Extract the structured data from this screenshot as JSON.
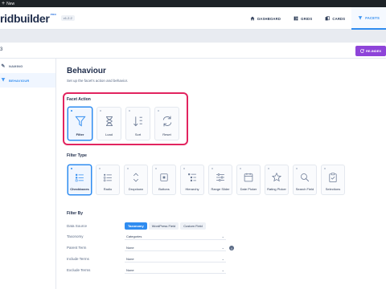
{
  "wpbar": {
    "plus": "+",
    "new_label": "New"
  },
  "header": {
    "logo_text": "ridbuilder",
    "pro_badge": "ᴘʀᴏ",
    "version": "v1.2.2",
    "nav": [
      {
        "label": "DASHBOARD",
        "icon": "home-icon"
      },
      {
        "label": "GRIDS",
        "icon": "grid-icon"
      },
      {
        "label": "CARDS",
        "icon": "cards-icon"
      },
      {
        "label": "FACETS",
        "icon": "filter-icon",
        "active": true
      }
    ]
  },
  "subheader": {
    "facet_id": "3",
    "reindex_label": "RE-INDEX"
  },
  "sidebar": {
    "items": [
      {
        "label": "NAMING",
        "icon": "pencil-icon"
      },
      {
        "label": "BEHAVIOUR",
        "icon": "filter-icon",
        "active": true
      }
    ]
  },
  "main": {
    "title": "Behaviour",
    "subtitle": "Set up the facet's action and behavior.",
    "facet_action": {
      "title": "Facet Action",
      "options": [
        {
          "label": "Filter",
          "icon": "funnel-icon",
          "selected": true
        },
        {
          "label": "Load",
          "icon": "hourglass-icon"
        },
        {
          "label": "Sort",
          "icon": "sort-icon"
        },
        {
          "label": "Reset",
          "icon": "refresh-icon"
        }
      ]
    },
    "filter_type": {
      "title": "Filter Type",
      "options": [
        {
          "label": "Checkboxes",
          "icon": "checkbox-list-icon",
          "selected": true
        },
        {
          "label": "Radio",
          "icon": "radio-list-icon"
        },
        {
          "label": "Dropdown",
          "icon": "dropdown-icon"
        },
        {
          "label": "Buttons",
          "icon": "button-icon"
        },
        {
          "label": "Hierarchy",
          "icon": "hierarchy-icon"
        },
        {
          "label": "Range Slider",
          "icon": "range-slider-icon"
        },
        {
          "label": "Date Picker",
          "icon": "calendar-icon"
        },
        {
          "label": "Rating Picker",
          "icon": "star-icon"
        },
        {
          "label": "Search Field",
          "icon": "search-icon"
        },
        {
          "label": "Selections",
          "icon": "clipboard-icon"
        }
      ]
    },
    "filter_by": {
      "title": "Filter By",
      "data_source_label": "Data Source",
      "data_source_options": [
        "Taxonomy",
        "WordPress Field",
        "Custom Field"
      ],
      "taxonomy_label": "Taxonomy",
      "taxonomy_value": "Categories",
      "parent_term_label": "Parent Term",
      "parent_term_value": "None",
      "include_terms_label": "Include Terms",
      "include_terms_value": "None",
      "exclude_terms_label": "Exclude Terms",
      "exclude_terms_value": "None",
      "info_glyph": "i",
      "chevron": "⌄"
    }
  },
  "colors": {
    "accent": "#2f8cf0",
    "highlight": "#e2245f",
    "reindex": "#8e44d9"
  }
}
